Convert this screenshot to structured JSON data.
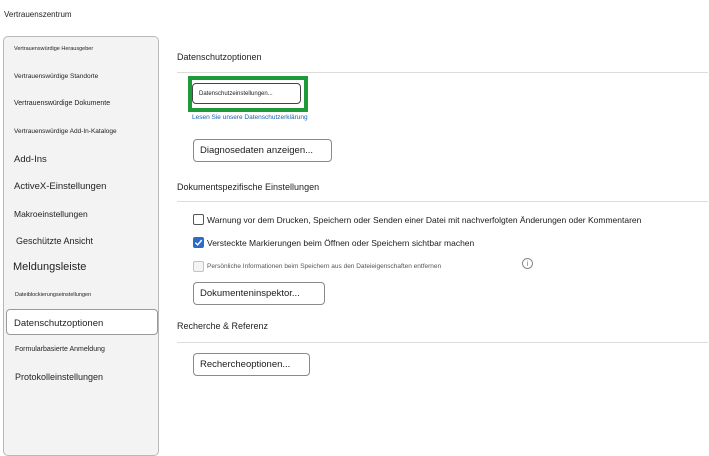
{
  "window": {
    "title": "Vertrauenszentrum"
  },
  "sidebar": {
    "items": [
      {
        "label": "Vertrauenswürdige Herausgeber"
      },
      {
        "label": "Vertrauenswürdige Standorte"
      },
      {
        "label": "Vertrauenswürdige Dokumente"
      },
      {
        "label": "Vertrauenswürdige Add-In-Kataloge"
      },
      {
        "label": "Add-Ins"
      },
      {
        "label": "ActiveX-Einstellungen"
      },
      {
        "label": "Makroeinstellungen"
      },
      {
        "label": "Geschützte Ansicht"
      },
      {
        "label": "Meldungsleiste"
      },
      {
        "label": "Dateiblockierungseinstellungen"
      },
      {
        "label": "Datenschutzoptionen"
      },
      {
        "label": "Formularbasierte Anmeldung"
      },
      {
        "label": "Protokolleinstellungen"
      }
    ],
    "selected": "Datenschutzoptionen"
  },
  "privacy": {
    "heading": "Datenschutzoptionen",
    "settings_button": "Datenschutzeinstellungen...",
    "statement_link": "Lesen Sie unsere Datenschutzerklärung",
    "diagnostics_button": "Diagnosedaten anzeigen..."
  },
  "document": {
    "heading": "Dokumentspezifische Einstellungen",
    "options": [
      {
        "label": "Warnung vor dem Drucken, Speichern oder Senden einer Datei mit nachverfolgten Änderungen oder Kommentaren",
        "checked": false
      },
      {
        "label": "Versteckte Markierungen beim Öffnen oder Speichern sichtbar machen",
        "checked": true
      },
      {
        "label": "Persönliche Informationen beim Speichern aus den Dateieigenschaften entfernen",
        "checked": false,
        "disabled": true
      }
    ],
    "inspector_button": "Dokumenteninspektor..."
  },
  "research": {
    "heading": "Recherche & Referenz",
    "options_button": "Rechercheoptionen..."
  },
  "icons": {
    "checkmark": "checkmark-icon",
    "info": "info-icon"
  },
  "colors": {
    "focus": "#1f9a3a",
    "link": "#1a5fb4",
    "checkbox": "#2c6bc9"
  }
}
